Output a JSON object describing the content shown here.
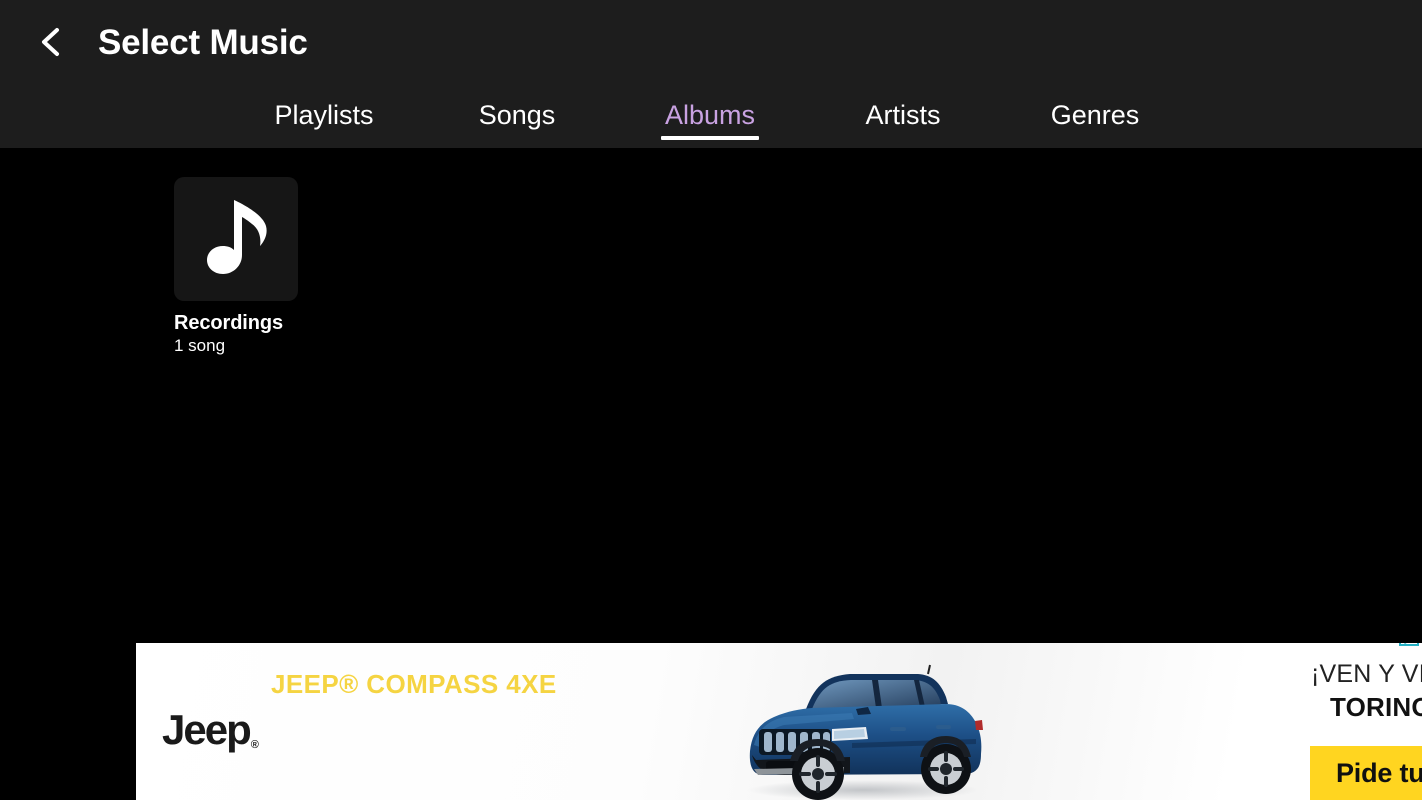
{
  "header": {
    "back_icon": "chevron-left-icon",
    "title": "Select Music"
  },
  "tabs": [
    {
      "label": "Playlists",
      "active": false
    },
    {
      "label": "Songs",
      "active": false
    },
    {
      "label": "Albums",
      "active": true
    },
    {
      "label": "Artists",
      "active": false
    },
    {
      "label": "Genres",
      "active": false
    }
  ],
  "albums": [
    {
      "name": "Recordings",
      "meta": "1 song",
      "art_icon": "music-note-icon"
    }
  ],
  "ad": {
    "headline": "JEEP® COMPASS 4XE",
    "brand_logo": "Jeep",
    "brand_mark": "®",
    "vehicle_image": "blue-jeep-compass-suv",
    "right_line1": "¡VEN Y VIS",
    "right_line2": "TORINO",
    "cta_label": "Pide tu",
    "adchoices_icon": "adchoices-icon"
  },
  "colors": {
    "header_bg": "#1d1d1d",
    "page_bg": "#000000",
    "active_tab": "#c9a2e2",
    "tab_text": "#ffffff",
    "album_art_bg": "#161616",
    "ad_bg": "#ffffff",
    "ad_headline_yellow": "#f5d442",
    "ad_cta_yellow": "#ffd520",
    "adchoices_teal": "#25b0c4"
  }
}
